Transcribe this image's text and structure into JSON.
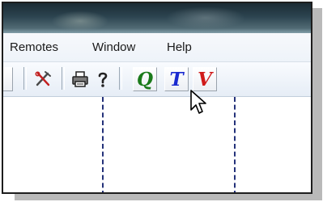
{
  "menu": {
    "remotes": "Remotes",
    "window": "Window",
    "help": "Help"
  },
  "toolbar": {
    "buttons": [
      {
        "name": "partial-button",
        "icon": "unknown"
      },
      {
        "name": "tools-button",
        "icon": "crossed-tools-icon"
      },
      {
        "name": "print-button",
        "icon": "printer-icon"
      },
      {
        "name": "help-button",
        "icon": "question-mark-icon"
      },
      {
        "name": "q-button",
        "label": "Q",
        "color": "#1a7a1a"
      },
      {
        "name": "t-button",
        "label": "T",
        "color": "#1a2ad0"
      },
      {
        "name": "v-button",
        "label": "V",
        "color": "#d01a1a"
      }
    ]
  },
  "colors": {
    "menubar_bg": "#f2f6fb",
    "toolbar_bg": "#e6edf6",
    "guide_line": "#24327a"
  }
}
